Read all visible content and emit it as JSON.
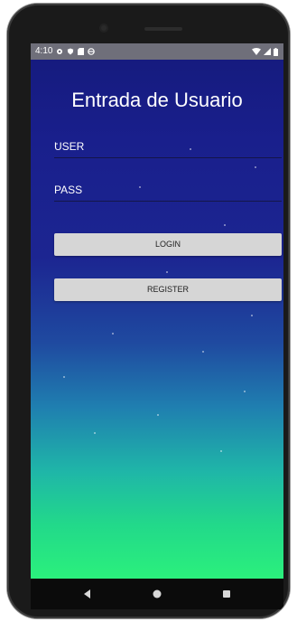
{
  "status_bar": {
    "time": "4:10"
  },
  "title": "Entrada de Usuario",
  "fields": {
    "user_label": "USER",
    "pass_label": "PASS"
  },
  "buttons": {
    "login": "LOGIN",
    "register": "REGISTER"
  },
  "navigation": {
    "back_icon": "triangle-back-icon",
    "home_icon": "circle-home-icon",
    "recents_icon": "square-recents-icon"
  },
  "colors": {
    "gradient_top": "#151a7c",
    "gradient_bottom": "#2bf07c",
    "button_bg": "#d6d6d6"
  }
}
